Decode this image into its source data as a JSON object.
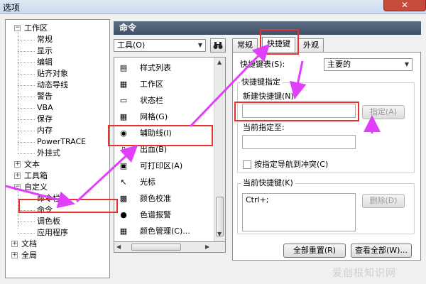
{
  "window": {
    "title": "选项",
    "close_label": "✕"
  },
  "tree": {
    "items": [
      {
        "label": "工作区",
        "expander": "−"
      },
      {
        "label": "常规"
      },
      {
        "label": "显示"
      },
      {
        "label": "编辑"
      },
      {
        "label": "贴齐对象"
      },
      {
        "label": "动态导线"
      },
      {
        "label": "警告"
      },
      {
        "label": "VBA"
      },
      {
        "label": "保存"
      },
      {
        "label": "内存"
      },
      {
        "label": "PowerTRACE"
      },
      {
        "label": "外挂式"
      },
      {
        "label": "文本",
        "expander": "+"
      },
      {
        "label": "工具箱",
        "expander": "+"
      },
      {
        "label": "自定义",
        "expander": "−"
      },
      {
        "label": "命令栏"
      },
      {
        "label": "命令",
        "selected": true
      },
      {
        "label": "调色板"
      },
      {
        "label": "应用程序"
      },
      {
        "label": "文档",
        "expander": "+"
      },
      {
        "label": "全局",
        "expander": "+"
      }
    ]
  },
  "section_title": "命令",
  "category_combo": {
    "value": "工具(O)"
  },
  "find_icon": "binoculars-icon",
  "commands": [
    {
      "label": "样式列表",
      "icon": "style-list-icon",
      "glyph": "▤"
    },
    {
      "label": "工作区",
      "icon": "workspace-icon",
      "glyph": "▦"
    },
    {
      "label": "状态栏",
      "icon": "status-bar-icon",
      "glyph": "▭"
    },
    {
      "label": "网格(G)",
      "icon": "grid-icon",
      "glyph": "▦"
    },
    {
      "label": "辅助线(I)",
      "icon": "eye-icon",
      "glyph": "◉",
      "selected": true
    },
    {
      "label": "出血(B)",
      "icon": "bleed-icon",
      "glyph": "▯"
    },
    {
      "label": "可打印区(A)",
      "icon": "printable-area-icon",
      "glyph": "▣"
    },
    {
      "label": "光标",
      "icon": "cursor-icon",
      "glyph": "↖"
    },
    {
      "label": "颜色校准",
      "icon": "color-calibration-icon",
      "glyph": "▩"
    },
    {
      "label": "色谱报警",
      "icon": "gamut-alarm-icon",
      "glyph": "●"
    },
    {
      "label": "颜色管理(C)...",
      "icon": "color-management-icon",
      "glyph": "▦"
    }
  ],
  "tabs": [
    {
      "label": "常规"
    },
    {
      "label": "快捷键",
      "active": true
    },
    {
      "label": "外观"
    }
  ],
  "shortcuts": {
    "table_label": "快捷键表(S):",
    "table_value": "主要的",
    "assign_group": "快捷键指定",
    "new_shortcut_label": "新建快捷键(N):",
    "new_shortcut_value": "",
    "assign_button": "指定(A)",
    "current_assign_label": "当前指定至:",
    "current_assign_value": "",
    "navigate_conflict_label": "按指定导航到冲突(C)",
    "current_shortcuts_group": "当前快捷键(K)",
    "current_shortcut_value": "Ctrl+;",
    "delete_button": "删除(D)",
    "reset_all_button": "全部重置(R)",
    "view_all_button": "查看全部(W)..."
  },
  "watermark": "爱创根知识网",
  "colors": {
    "highlight": "#e8312c",
    "arrow": "#e040fb",
    "header_bg": "#4a5a70"
  }
}
